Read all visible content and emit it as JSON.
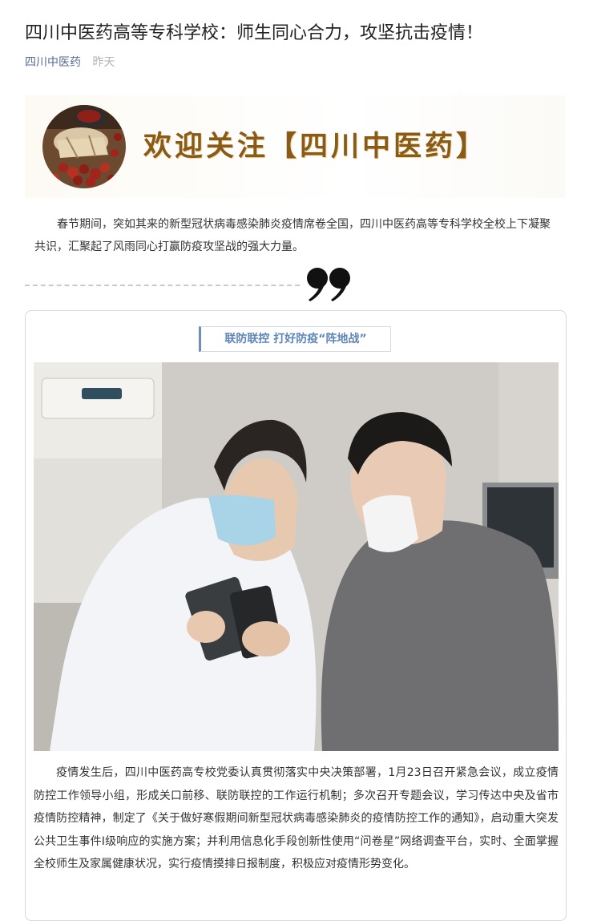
{
  "article": {
    "title": "四川中医药高等专科学校：师生同心合力，攻坚抗击疫情！",
    "source": "四川中医药",
    "time": "昨天"
  },
  "banner": {
    "welcome_text": "欢迎关注【四川中医药",
    "close_bracket": "】"
  },
  "intro": "春节期间，突如其来的新型冠状病毒感染肺炎疫情席卷全国，四川中医药高等专科学校全校上下凝聚共识，汇聚起了风雨同心打赢防疫攻坚战的强大力量。",
  "section": {
    "tag": "联防联控 打好防疫“阵地战”",
    "paragraph": "疫情发生后，四川中医药高专校党委认真贯彻落实中央决策部署，1月23日召开紧急会议，成立疫情防控工作领导小组，形成关口前移、联防联控的工作运行机制；多次召开专题会议，学习传达中央及省市疫情防控精神，制定了《关于做好寒假期间新型冠状病毒感染肺炎的疫情防控工作的通知》，启动重大突发公共卫生事件I级响应的实施方案；并利用信息化手段创新性使用“问卷星”网络调查平台，实时、全面掌握全校师生及家属健康状况，实行疫情摸排日报制度，积极应对疫情形势变化。"
  },
  "colors": {
    "source_link": "#576b95",
    "tag_text": "#5e86b8",
    "banner_text": "#8a5a17"
  }
}
